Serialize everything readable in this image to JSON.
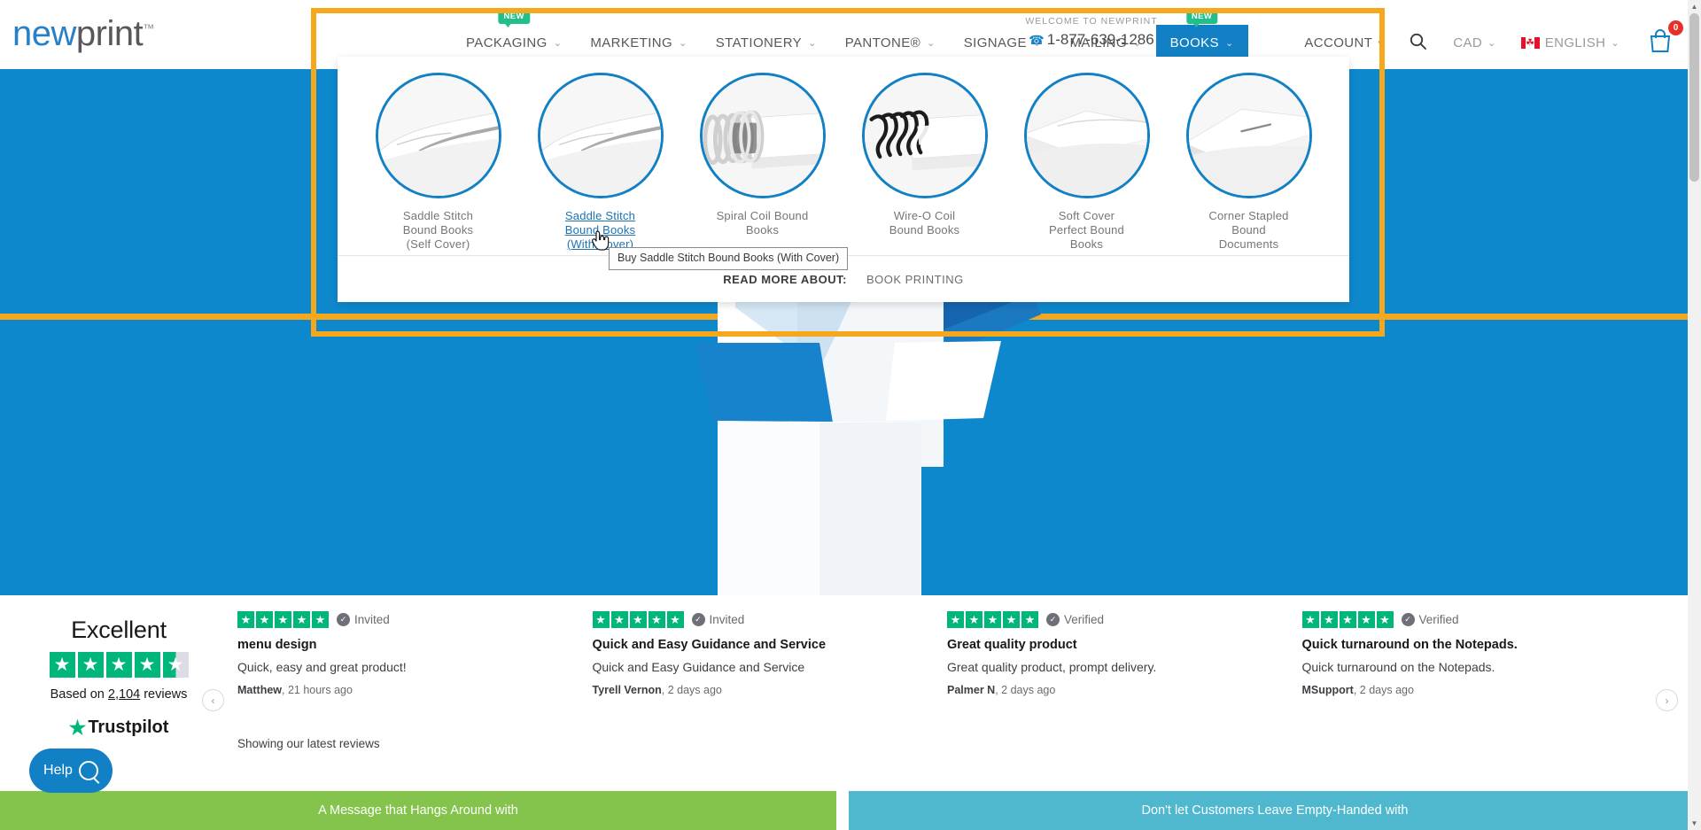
{
  "brand": {
    "logo_prefix": "new",
    "logo_suffix": "print",
    "trademark": "™"
  },
  "header": {
    "nav": [
      {
        "label": "PACKAGING",
        "caret": "⌄",
        "badge": "NEW",
        "active": false
      },
      {
        "label": "MARKETING",
        "caret": "⌄",
        "badge": "",
        "active": false
      },
      {
        "label": "STATIONERY",
        "caret": "⌄",
        "badge": "",
        "active": false
      },
      {
        "label": "PANTONE®",
        "caret": "⌄",
        "badge": "",
        "active": false
      },
      {
        "label": "SIGNAGE",
        "caret": "⌄",
        "badge": "",
        "active": false
      },
      {
        "label": "MAILING",
        "caret": "⌄",
        "badge": "",
        "active": false
      },
      {
        "label": "BOOKS",
        "caret": "⌄",
        "badge": "NEW",
        "active": true
      }
    ],
    "welcome_text": "WELCOME TO NEWPRINT",
    "phone": "1-877-639-1286",
    "phone_icon": "☎",
    "account_label": "ACCOUNT",
    "account_caret": "▾",
    "search_icon": "search-icon",
    "currency_label": "CAD",
    "currency_caret": "⌄",
    "language_label": "ENGLISH",
    "language_caret": "⌄",
    "flag_glyph": "☘",
    "cart_count": "0"
  },
  "megamenu": {
    "items": [
      {
        "label": "Saddle Stitch\nBound Books\n(Self Cover)",
        "icon": "saddle-stitch-self-cover",
        "hovered": false
      },
      {
        "label": "Saddle Stitch\nBound Books\n(With Cover)",
        "icon": "saddle-stitch-with-cover",
        "hovered": true
      },
      {
        "label": "Spiral Coil Bound\nBooks",
        "icon": "spiral-coil-bound",
        "hovered": false
      },
      {
        "label": "Wire-O Coil\nBound Books",
        "icon": "wire-o-coil-bound",
        "hovered": false
      },
      {
        "label": "Soft Cover\nPerfect Bound\nBooks",
        "icon": "soft-cover-perfect-bound",
        "hovered": false
      },
      {
        "label": "Corner Stapled\nBound\nDocuments",
        "icon": "corner-stapled-bound",
        "hovered": false
      }
    ],
    "read_more_label": "READ MORE ABOUT:",
    "read_more_link": "BOOK PRINTING"
  },
  "tooltip": {
    "text": "Buy Saddle Stitch Bound Books (With Cover)"
  },
  "trustpilot": {
    "rating_word": "Excellent",
    "stars_filled": 4,
    "stars_total": 5,
    "half_star": true,
    "based_on_prefix": "Based on ",
    "review_count": "2,104",
    "based_on_suffix": " reviews",
    "logo_text": "Trustpilot",
    "logo_star": "★",
    "showing_text": "Showing our latest reviews",
    "prev_arrow": "‹",
    "next_arrow": "›",
    "reviews": [
      {
        "stars": 5,
        "badge": "Invited",
        "title": "menu design",
        "body": "Quick, easy and great product!",
        "author": "Matthew",
        "time": ", 21 hours ago"
      },
      {
        "stars": 5,
        "badge": "Invited",
        "title": "Quick and Easy Guidance and Service",
        "body": "Quick and Easy Guidance and Service",
        "author": "Tyrell Vernon",
        "time": ", 2 days ago"
      },
      {
        "stars": 5,
        "badge": "Verified",
        "title": "Great quality product",
        "body": "Great quality product, prompt delivery.",
        "author": "Palmer N",
        "time": ", 2 days ago"
      },
      {
        "stars": 5,
        "badge": "Verified",
        "title": "Quick turnaround on the Notepads.",
        "body": "Quick turnaround on the Notepads.",
        "author": "MSupport",
        "time": ", 2 days ago"
      }
    ]
  },
  "help_widget": {
    "label": "Help",
    "icon": "magnifier-icon"
  },
  "bands": [
    {
      "text": "A Message that Hangs Around with",
      "color": "#84c44d"
    },
    {
      "text": "Don't let Customers Leave Empty-Handed with",
      "color": "#4fb8cf"
    }
  ],
  "colors": {
    "brand_blue": "#1280c4",
    "hero_blue": "#0e88cd",
    "highlight_orange": "#f5a81c",
    "badge_green": "#21c08b",
    "trustpilot_green": "#00b67a",
    "cart_red": "#e8302a"
  },
  "scrollbar": {
    "up": "▲",
    "down": "▼"
  }
}
